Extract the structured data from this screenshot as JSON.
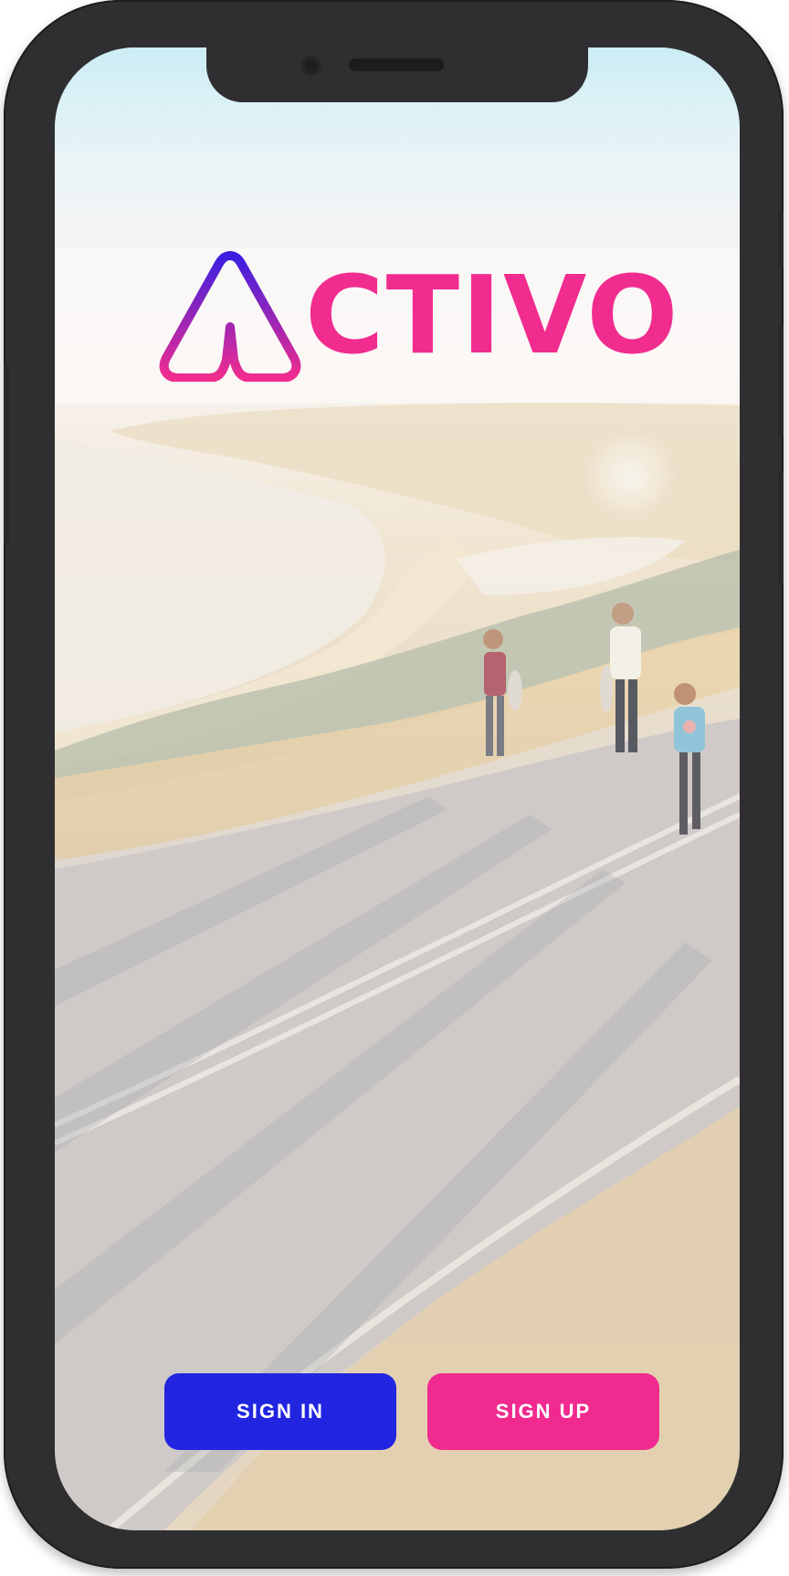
{
  "app": {
    "logo_text": "CTIVO",
    "brand_colors": {
      "primary_pink": "#f02a8f",
      "primary_blue": "#2125e0",
      "logo_gradient_start": "#3b1fe0",
      "logo_gradient_end": "#f12c8f"
    }
  },
  "actions": {
    "sign_in_label": "SIGN IN",
    "sign_up_label": "SIGN UP"
  },
  "icons": {
    "logo_mark": "triangle-a-icon",
    "camera": "camera-icon",
    "speaker": "speaker-icon"
  }
}
